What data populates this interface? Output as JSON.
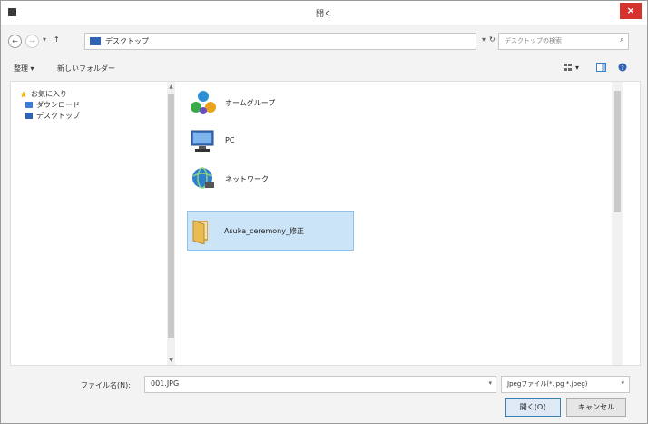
{
  "window": {
    "title": "開く",
    "close_glyph": "×"
  },
  "nav": {
    "back_glyph": "←",
    "forward_glyph": "→",
    "dropdown_glyph": "▾",
    "up_glyph": "↑",
    "address_path": "デスクトップ",
    "address_dropdown_glyph": "▾",
    "refresh_glyph": "↻",
    "search_placeholder": "デスクトップの検索",
    "search_glyph": "⌕"
  },
  "toolbar": {
    "organize_label": "整理 ▾",
    "new_folder_label": "新しいフォルダー",
    "view_glyph": "▾"
  },
  "sidebar": {
    "items": [
      {
        "label": "お気に入り",
        "icon": "star-icon",
        "color": "#f2b51a"
      },
      {
        "label": "ダウンロード",
        "icon": "download-folder-icon",
        "color": "#3b7fd0"
      },
      {
        "label": "デスクトップ",
        "icon": "desktop-icon",
        "color": "#2f64b5"
      }
    ]
  },
  "files": [
    {
      "label": "ホームグループ",
      "icon": "homegroup-icon"
    },
    {
      "label": "PC",
      "icon": "pc-icon"
    },
    {
      "label": "ネットワーク",
      "icon": "network-icon"
    },
    {
      "label": "Asuka_ceremony_修正",
      "icon": "folder-icon",
      "selected": true
    }
  ],
  "bottom": {
    "filename_label": "ファイル名(N):",
    "filename_value": "001.JPG",
    "filetype_value": "Jpegファイル(*.jpg;*.jpeg)",
    "open_label": "開く(O)",
    "cancel_label": "キャンセル"
  },
  "colors": {
    "accent": "#3c7fb1",
    "selection": "#cce4f7",
    "close": "#d6332f"
  }
}
